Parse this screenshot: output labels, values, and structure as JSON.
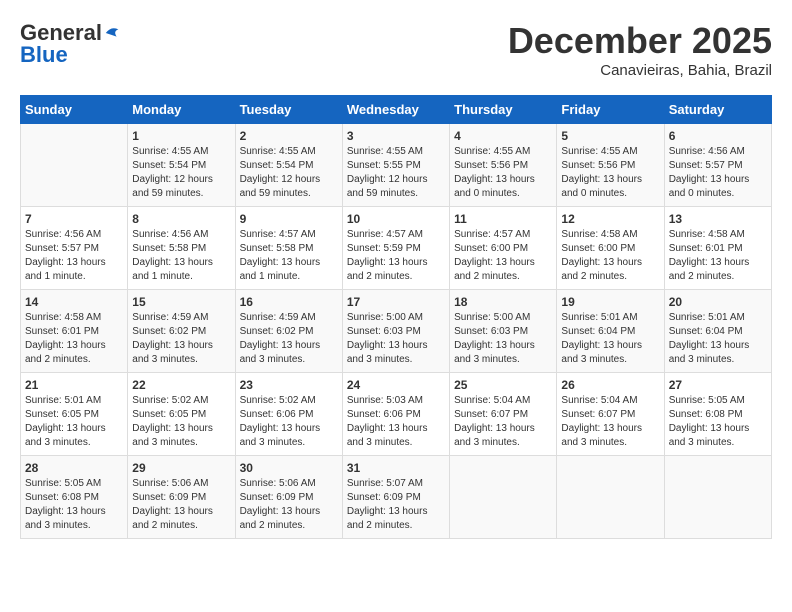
{
  "logo": {
    "general": "General",
    "blue": "Blue"
  },
  "title": "December 2025",
  "location": "Canavieiras, Bahia, Brazil",
  "weekdays": [
    "Sunday",
    "Monday",
    "Tuesday",
    "Wednesday",
    "Thursday",
    "Friday",
    "Saturday"
  ],
  "weeks": [
    [
      {
        "day": "",
        "content": ""
      },
      {
        "day": "1",
        "content": "Sunrise: 4:55 AM\nSunset: 5:54 PM\nDaylight: 12 hours and 59 minutes."
      },
      {
        "day": "2",
        "content": "Sunrise: 4:55 AM\nSunset: 5:54 PM\nDaylight: 12 hours and 59 minutes."
      },
      {
        "day": "3",
        "content": "Sunrise: 4:55 AM\nSunset: 5:55 PM\nDaylight: 12 hours and 59 minutes."
      },
      {
        "day": "4",
        "content": "Sunrise: 4:55 AM\nSunset: 5:56 PM\nDaylight: 13 hours and 0 minutes."
      },
      {
        "day": "5",
        "content": "Sunrise: 4:55 AM\nSunset: 5:56 PM\nDaylight: 13 hours and 0 minutes."
      },
      {
        "day": "6",
        "content": "Sunrise: 4:56 AM\nSunset: 5:57 PM\nDaylight: 13 hours and 0 minutes."
      }
    ],
    [
      {
        "day": "7",
        "content": "Sunrise: 4:56 AM\nSunset: 5:57 PM\nDaylight: 13 hours and 1 minute."
      },
      {
        "day": "8",
        "content": "Sunrise: 4:56 AM\nSunset: 5:58 PM\nDaylight: 13 hours and 1 minute."
      },
      {
        "day": "9",
        "content": "Sunrise: 4:57 AM\nSunset: 5:58 PM\nDaylight: 13 hours and 1 minute."
      },
      {
        "day": "10",
        "content": "Sunrise: 4:57 AM\nSunset: 5:59 PM\nDaylight: 13 hours and 2 minutes."
      },
      {
        "day": "11",
        "content": "Sunrise: 4:57 AM\nSunset: 6:00 PM\nDaylight: 13 hours and 2 minutes."
      },
      {
        "day": "12",
        "content": "Sunrise: 4:58 AM\nSunset: 6:00 PM\nDaylight: 13 hours and 2 minutes."
      },
      {
        "day": "13",
        "content": "Sunrise: 4:58 AM\nSunset: 6:01 PM\nDaylight: 13 hours and 2 minutes."
      }
    ],
    [
      {
        "day": "14",
        "content": "Sunrise: 4:58 AM\nSunset: 6:01 PM\nDaylight: 13 hours and 2 minutes."
      },
      {
        "day": "15",
        "content": "Sunrise: 4:59 AM\nSunset: 6:02 PM\nDaylight: 13 hours and 3 minutes."
      },
      {
        "day": "16",
        "content": "Sunrise: 4:59 AM\nSunset: 6:02 PM\nDaylight: 13 hours and 3 minutes."
      },
      {
        "day": "17",
        "content": "Sunrise: 5:00 AM\nSunset: 6:03 PM\nDaylight: 13 hours and 3 minutes."
      },
      {
        "day": "18",
        "content": "Sunrise: 5:00 AM\nSunset: 6:03 PM\nDaylight: 13 hours and 3 minutes."
      },
      {
        "day": "19",
        "content": "Sunrise: 5:01 AM\nSunset: 6:04 PM\nDaylight: 13 hours and 3 minutes."
      },
      {
        "day": "20",
        "content": "Sunrise: 5:01 AM\nSunset: 6:04 PM\nDaylight: 13 hours and 3 minutes."
      }
    ],
    [
      {
        "day": "21",
        "content": "Sunrise: 5:01 AM\nSunset: 6:05 PM\nDaylight: 13 hours and 3 minutes."
      },
      {
        "day": "22",
        "content": "Sunrise: 5:02 AM\nSunset: 6:05 PM\nDaylight: 13 hours and 3 minutes."
      },
      {
        "day": "23",
        "content": "Sunrise: 5:02 AM\nSunset: 6:06 PM\nDaylight: 13 hours and 3 minutes."
      },
      {
        "day": "24",
        "content": "Sunrise: 5:03 AM\nSunset: 6:06 PM\nDaylight: 13 hours and 3 minutes."
      },
      {
        "day": "25",
        "content": "Sunrise: 5:04 AM\nSunset: 6:07 PM\nDaylight: 13 hours and 3 minutes."
      },
      {
        "day": "26",
        "content": "Sunrise: 5:04 AM\nSunset: 6:07 PM\nDaylight: 13 hours and 3 minutes."
      },
      {
        "day": "27",
        "content": "Sunrise: 5:05 AM\nSunset: 6:08 PM\nDaylight: 13 hours and 3 minutes."
      }
    ],
    [
      {
        "day": "28",
        "content": "Sunrise: 5:05 AM\nSunset: 6:08 PM\nDaylight: 13 hours and 3 minutes."
      },
      {
        "day": "29",
        "content": "Sunrise: 5:06 AM\nSunset: 6:09 PM\nDaylight: 13 hours and 2 minutes."
      },
      {
        "day": "30",
        "content": "Sunrise: 5:06 AM\nSunset: 6:09 PM\nDaylight: 13 hours and 2 minutes."
      },
      {
        "day": "31",
        "content": "Sunrise: 5:07 AM\nSunset: 6:09 PM\nDaylight: 13 hours and 2 minutes."
      },
      {
        "day": "",
        "content": ""
      },
      {
        "day": "",
        "content": ""
      },
      {
        "day": "",
        "content": ""
      }
    ]
  ]
}
